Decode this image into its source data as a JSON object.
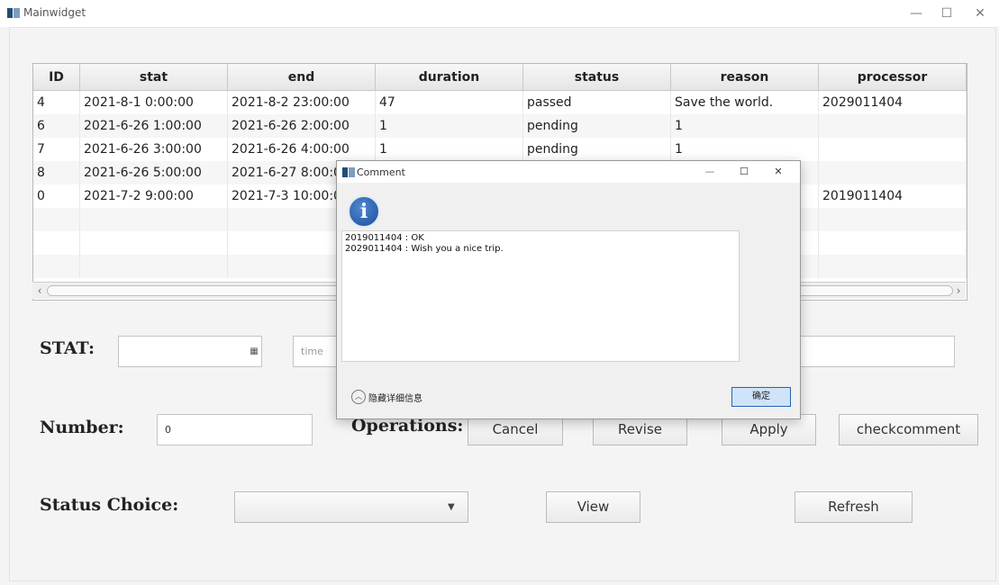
{
  "window": {
    "title": "Mainwidget",
    "minimize": "—",
    "maximize": "☐",
    "close": "✕"
  },
  "table": {
    "columns": [
      "ID",
      "stat",
      "end",
      "duration",
      "status",
      "reason",
      "processor"
    ],
    "rows": [
      [
        "4",
        "2021-8-1 0:00:00",
        "2021-8-2 23:00:00",
        "47",
        "passed",
        "Save the world.",
        "2029011404"
      ],
      [
        "6",
        "2021-6-26 1:00:00",
        "2021-6-26 2:00:00",
        "1",
        "pending",
        "1",
        ""
      ],
      [
        "7",
        "2021-6-26 3:00:00",
        "2021-6-26 4:00:00",
        "1",
        "pending",
        "1",
        ""
      ],
      [
        "8",
        "2021-6-26 5:00:00",
        "2021-6-27 8:00:00",
        "",
        "",
        "",
        ""
      ],
      [
        "0",
        "2021-7-2 9:00:00",
        "2021-7-3 10:00:00",
        "",
        "",
        "",
        "2019011404"
      ]
    ],
    "scroll_left": "‹",
    "scroll_right": "›"
  },
  "form": {
    "stat_label": "STAT:",
    "stat_value": "",
    "calendar_icon": "▦",
    "time_placeholder": "time",
    "number_label": "Number:",
    "number_value": "0",
    "operations_label": "Operations:",
    "cancel_label": "Cancel",
    "revise_label": "Revise",
    "apply_label": "Apply",
    "checkcomment_label": "checkcomment",
    "status_choice_label": "Status Choice:",
    "status_choice_value": "",
    "dropdown_arrow": "▼",
    "view_label": "View",
    "refresh_label": "Refresh"
  },
  "dialog": {
    "title": "Comment",
    "minimize": "—",
    "maximize": "☐",
    "close": "✕",
    "info_glyph": "i",
    "comments": [
      "2019011404 : OK",
      "2029011404 : Wish you a nice trip."
    ],
    "toggle_glyph": "︿",
    "hide_details_label": "隐藏详细信息",
    "ok_label": "确定"
  },
  "colors": {
    "accent": "#cfe3f9",
    "info": "#2a62b6"
  }
}
